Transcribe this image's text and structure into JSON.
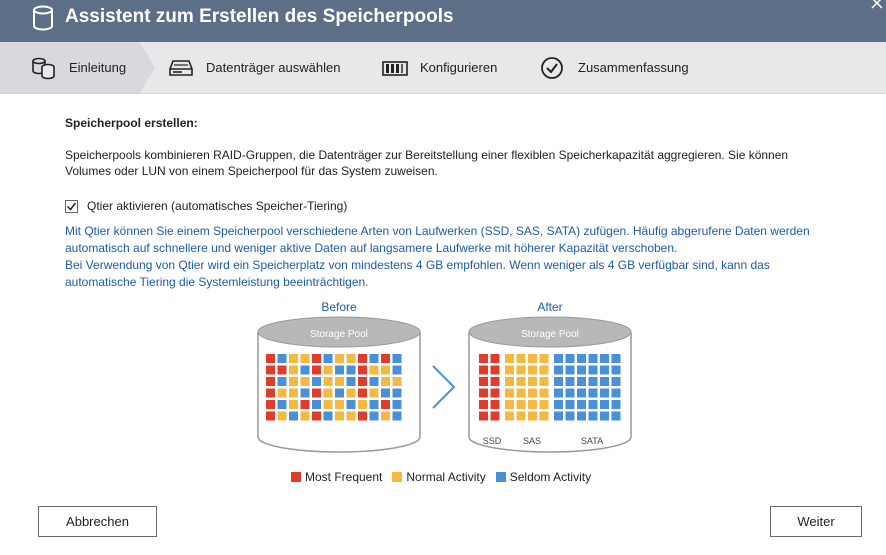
{
  "window": {
    "title": "Assistent zum Erstellen des Speicherpools",
    "close_icon": "close-icon",
    "title_icon": "storage-cylinder-icon"
  },
  "steps": [
    {
      "label": "Einleitung",
      "icon": "storage-pool-icon",
      "active": true
    },
    {
      "label": "Datenträger auswählen",
      "icon": "disk-drive-icon",
      "active": false
    },
    {
      "label": "Konfigurieren",
      "icon": "raid-config-icon",
      "active": false
    },
    {
      "label": "Zusammenfassung",
      "icon": "check-circle-icon",
      "active": false
    }
  ],
  "content": {
    "heading": "Speicherpool erstellen:",
    "description": "Speicherpools kombinieren RAID-Gruppen, die Datenträger zur Bereitstellung einer flexiblen Speicherkapazität aggregieren. Sie können Volumes oder LUN von einem Speicherpool für das System zuweisen.",
    "qtier": {
      "checked": true,
      "label": "Qtier aktivieren (automatisches Speicher-Tiering)"
    },
    "qtier_info_1": "Mit Qtier können Sie einem Speicherpool verschiedene Arten von Laufwerken (SSD, SAS, SATA) zufügen. Häufig abgerufene Daten werden automatisch auf schnellere und weniger aktive Daten auf langsamere Laufwerke mit höherer Kapazität verschoben.",
    "qtier_info_2": "Bei Verwendung von Qtier wird ein Speicherplatz von mindestens 4 GB empfohlen. Wenn weniger als 4 GB verfügbar sind, kann das automatische Tiering die Systemleistung beeinträchtigen."
  },
  "diagram": {
    "before_label": "Before",
    "after_label": "After",
    "pool_label": "Storage Pool",
    "tiers": [
      "SSD",
      "SAS",
      "SATA"
    ],
    "colors": {
      "frequent": "#e03c2c",
      "normal": "#f4b942",
      "seldom": "#4a90d9",
      "accent_blue": "#1c5ca6",
      "arrow": "#4a90d9"
    }
  },
  "legend": [
    {
      "label": "Most Frequent",
      "color": "#e03c2c"
    },
    {
      "label": "Normal Activity",
      "color": "#f4b942"
    },
    {
      "label": "Seldom Activity",
      "color": "#4a90d9"
    }
  ],
  "buttons": {
    "cancel": "Abbrechen",
    "next": "Weiter"
  }
}
